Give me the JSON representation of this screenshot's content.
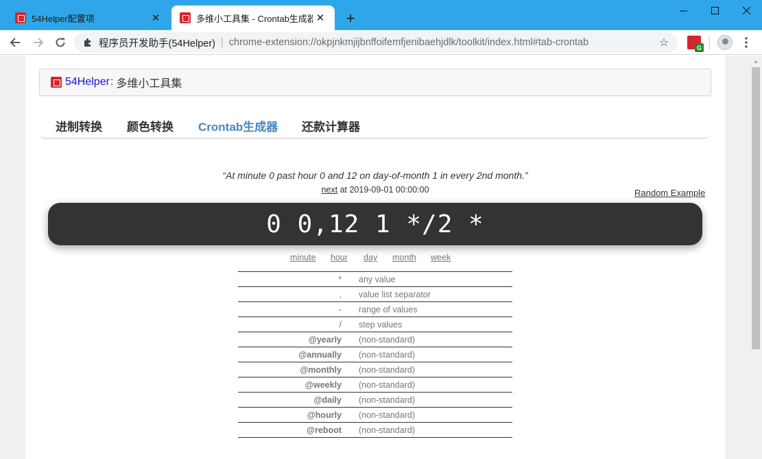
{
  "browser": {
    "tabs": [
      {
        "title": "54Helper配置项",
        "active": false
      },
      {
        "title": "多维小工具集 - Crontab生成器",
        "active": true
      }
    ],
    "new_tab": "+",
    "window_controls": {
      "minimize": "—",
      "maximize": "☐",
      "close": "✕"
    },
    "omnibox": {
      "site_name": "程序员开发助手(54Helper)",
      "url": "chrome-extension://okpjnkmjijbnffoifemfjenibaehjdlk/toolkit/index.html#tab-crontab",
      "separator": "|"
    },
    "extension_badge": "G",
    "icons": [
      "back-arrow-icon",
      "forward-arrow-icon",
      "reload-icon",
      "puzzle-icon",
      "star-icon",
      "extension-icon",
      "avatar-icon",
      "kebab-menu-icon"
    ]
  },
  "page": {
    "header": {
      "brand": "54Helper",
      "colon": ":",
      "subtitle": "多维小工具集"
    },
    "tabs": [
      {
        "label": "进制转换",
        "active": false
      },
      {
        "label": "颜色转换",
        "active": false
      },
      {
        "label": "Crontab生成器",
        "active": true
      },
      {
        "label": "还款计算器",
        "active": false
      }
    ],
    "crontab": {
      "description": "“At minute 0 past hour 0 and 12 on day-of-month 1 in every 2nd month.”",
      "next_label": "next",
      "next_time": " at 2019-09-01 00:00:00",
      "random_example": "Random Example",
      "expression": "0 0,12 1 */2 *",
      "fields": [
        "minute",
        "hour",
        "day",
        "month",
        "week"
      ],
      "legend": [
        {
          "symbol": "*",
          "meaning": "any value",
          "bold": false
        },
        {
          "symbol": ",",
          "meaning": "value list separator",
          "bold": false
        },
        {
          "symbol": "-",
          "meaning": "range of values",
          "bold": false
        },
        {
          "symbol": "/",
          "meaning": "step values",
          "bold": false
        },
        {
          "symbol": "@yearly",
          "meaning": "(non-standard)",
          "bold": true
        },
        {
          "symbol": "@annually",
          "meaning": "(non-standard)",
          "bold": true
        },
        {
          "symbol": "@monthly",
          "meaning": "(non-standard)",
          "bold": true
        },
        {
          "symbol": "@weekly",
          "meaning": "(non-standard)",
          "bold": true
        },
        {
          "symbol": "@daily",
          "meaning": "(non-standard)",
          "bold": true
        },
        {
          "symbol": "@hourly",
          "meaning": "(non-standard)",
          "bold": true
        },
        {
          "symbol": "@reboot",
          "meaning": "(non-standard)",
          "bold": true
        }
      ]
    }
  },
  "colors": {
    "titlebar": "#2fa6e9",
    "brand_link": "#1a12c9",
    "active_tab": "#4a86c0",
    "cron_box": "#333333",
    "logo_red": "#d4262b"
  }
}
